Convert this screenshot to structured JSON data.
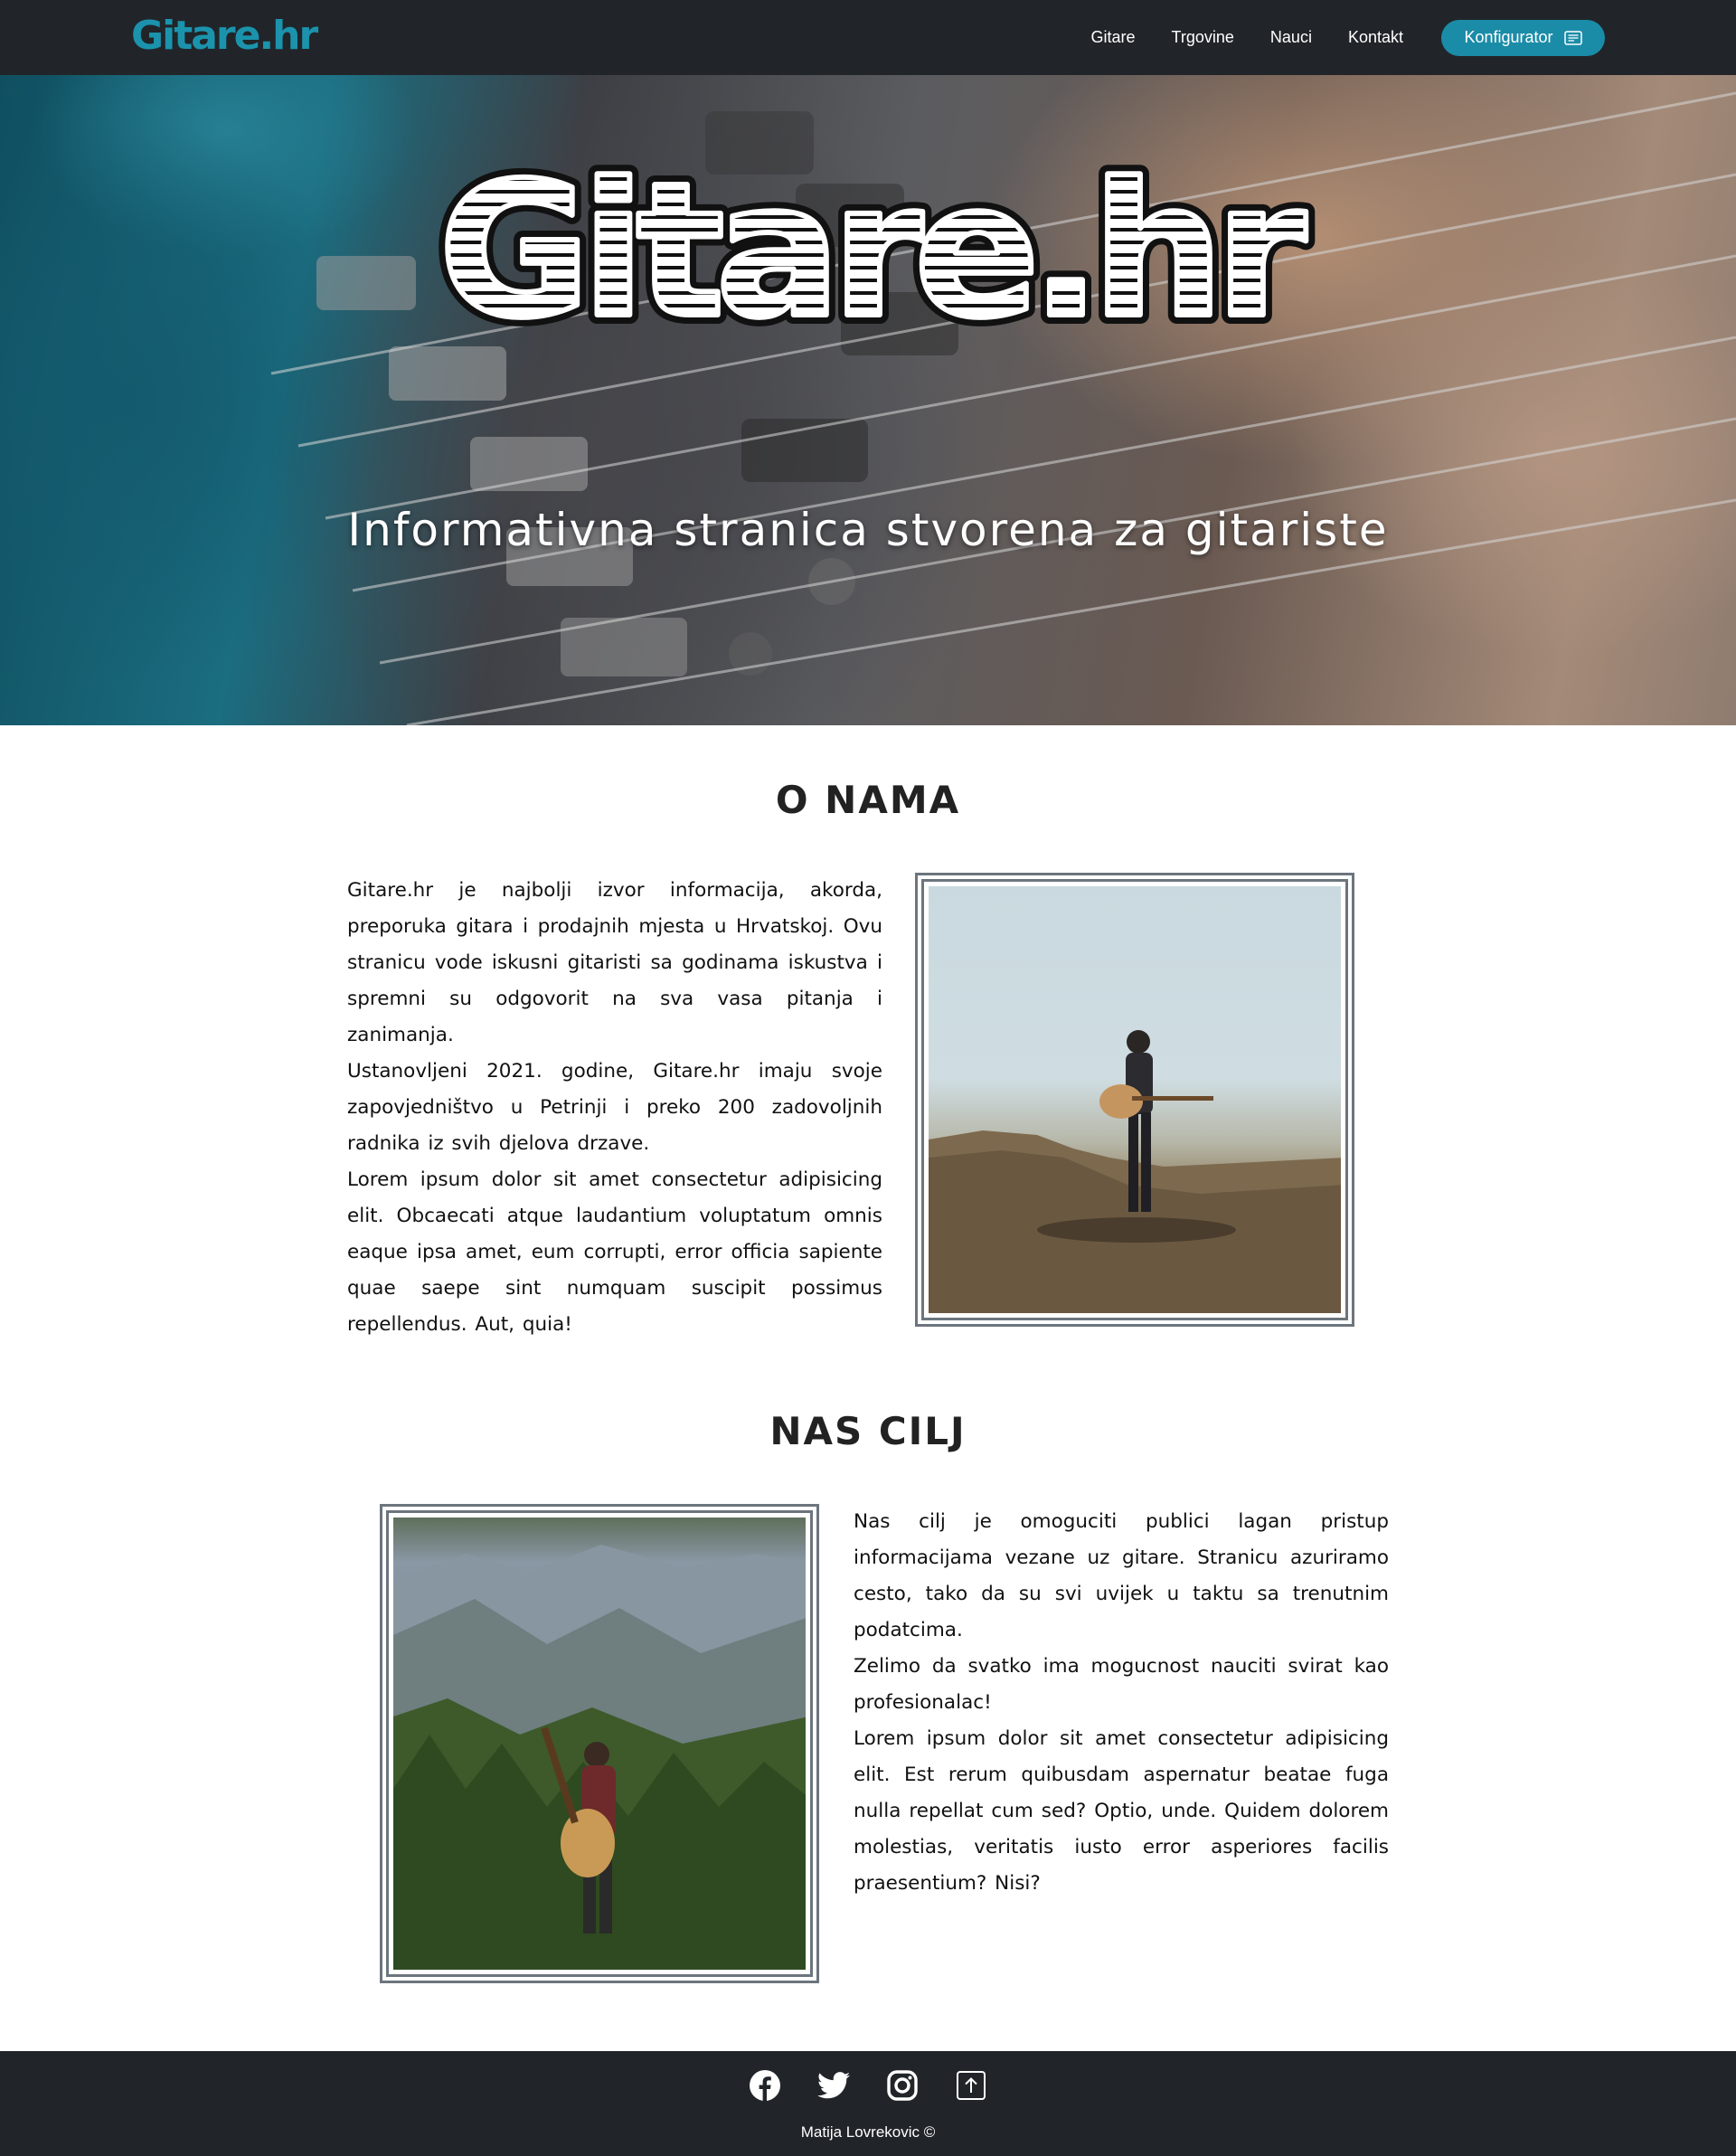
{
  "navbar": {
    "brand": "Gitare.hr",
    "links": [
      "Gitare",
      "Trgovine",
      "Nauci",
      "Kontakt"
    ],
    "cta_label": "Konfigurator",
    "cta_icon": "card-text-icon",
    "brand_color": "#1b93ad",
    "cta_color": "#1b8ca8"
  },
  "hero": {
    "logo_text": "Gitare.hr",
    "tagline": "Informativna stranica stvorena za gitariste"
  },
  "about": {
    "title": "O NAMA",
    "paragraphs": [
      "Gitare.hr je najbolji izvor informacija, akorda, preporuka gitara i prodajnih mjesta u Hrvatskoj. Ovu stranicu vode iskusni gitaristi sa godinama iskustva i spremni su odgovorit na sva vasa pitanja i zanimanja.",
      "Ustanovljeni 2021. godine, Gitare.hr imaju svoje zapovjedništvo u Petrinji i preko 200 zadovoljnih radnika iz svih djelova drzave.",
      "Lorem ipsum dolor sit amet consectetur adipisicing elit. Obcaecati atque laudantium voluptatum omnis eaque ipsa amet, eum corrupti, error officia sapiente quae saepe sint numquam suscipit possimus repellendus. Aut, quia!"
    ]
  },
  "goal": {
    "title": "NAS CILJ",
    "paragraphs": [
      "Nas cilj je omoguciti publici lagan pristup informacijama vezane uz gitare. Stranicu azuriramo cesto, tako da su svi uvijek u taktu sa trenutnim podatcima.",
      "Zelimo da svatko ima mogucnost nauciti svirat kao profesionalac!",
      "Lorem ipsum dolor sit amet consectetur adipisicing elit. Est rerum quibusdam aspernatur beatae fuga nulla repellat cum sed? Optio, unde. Quidem dolorem molestias, veritatis iusto error asperiores facilis praesentium? Nisi?"
    ]
  },
  "footer": {
    "social_icons": [
      "facebook-icon",
      "twitter-icon",
      "instagram-icon",
      "arrow-up-square-icon"
    ],
    "copyright": "Matija Lovrekovic ©"
  }
}
